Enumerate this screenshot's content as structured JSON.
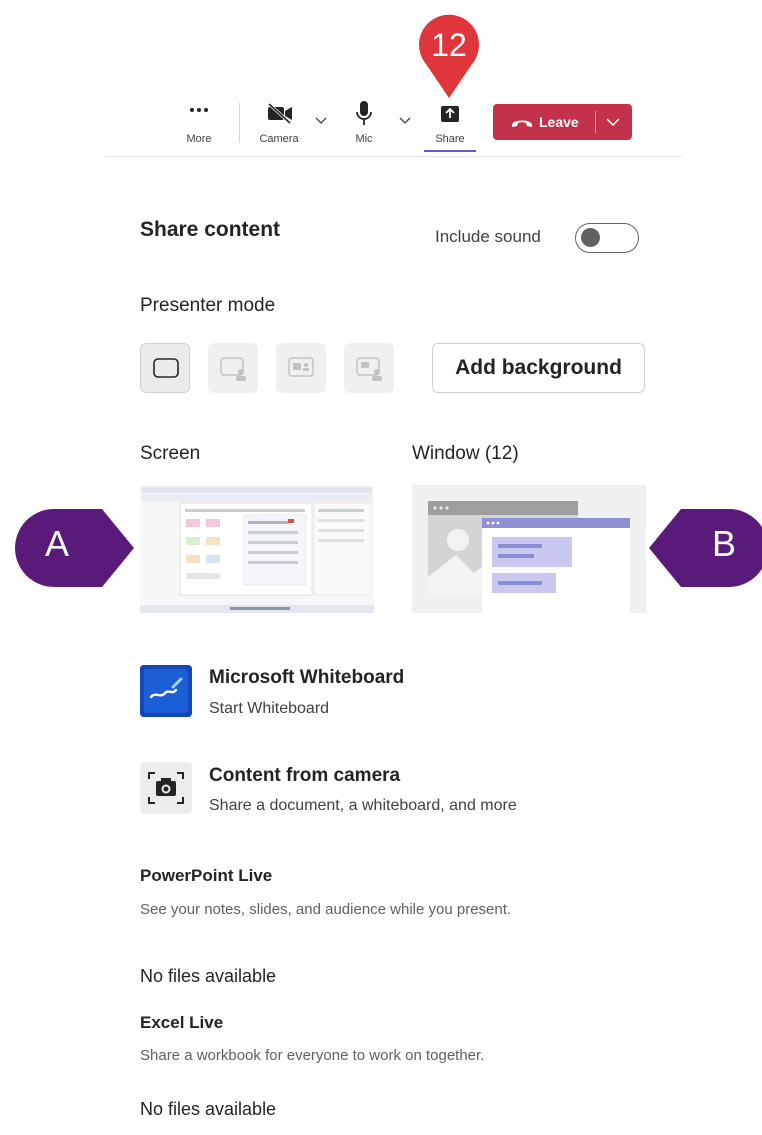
{
  "callouts": {
    "step": "12",
    "left_marker": "A",
    "right_marker": "B"
  },
  "toolbar": {
    "more_label": "More",
    "camera_label": "Camera",
    "mic_label": "Mic",
    "share_label": "Share",
    "leave_label": "Leave",
    "leave_color": "#c4314b",
    "accent": "#5b5fc7",
    "icons": [
      "more-dots-icon",
      "camera-off-icon",
      "chevron-down-icon",
      "microphone-icon",
      "share-tray-icon",
      "phone-hangup-icon"
    ]
  },
  "panel": {
    "title": "Share content",
    "include_sound_label": "Include sound",
    "include_sound_on": false,
    "presenter_mode_label": "Presenter mode",
    "add_background_label": "Add background",
    "screen_label": "Screen",
    "window_label": "Window (12)",
    "whiteboard": {
      "title": "Microsoft Whiteboard",
      "subtitle": "Start Whiteboard"
    },
    "camera_content": {
      "title": "Content from camera",
      "subtitle": "Share a document, a whiteboard, and more"
    },
    "powerpoint": {
      "title": "PowerPoint Live",
      "subtitle": "See your notes, slides, and audience while you present.",
      "empty": "No files available"
    },
    "excel": {
      "title": "Excel Live",
      "subtitle": "Share a workbook for everyone to work on together.",
      "empty": "No files available"
    }
  },
  "colors": {
    "callout_red": "#e0363b",
    "callout_purple": "#5a1a7a"
  }
}
